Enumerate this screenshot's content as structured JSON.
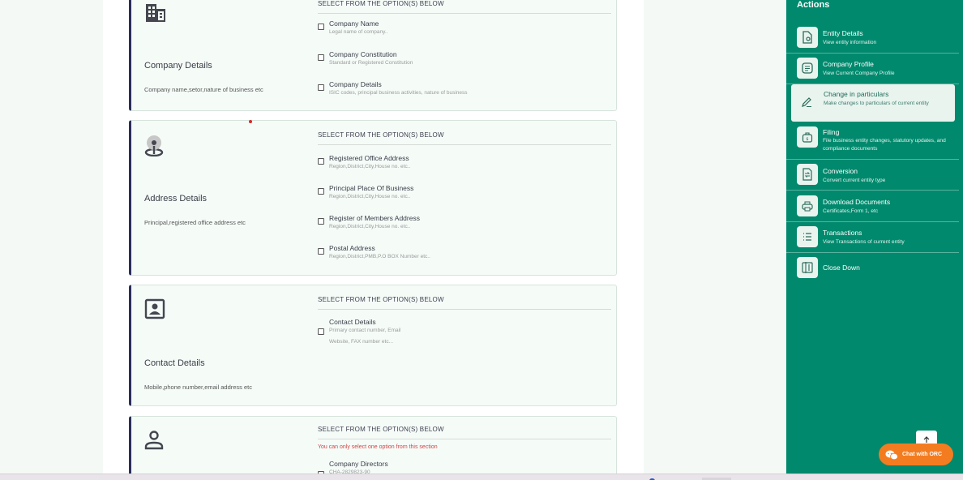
{
  "select_header": "SELECT FROM THE OPTION(S) BELOW",
  "cards": {
    "company": {
      "title": "Company Details",
      "desc": "Company name,setor,nature of business etc",
      "icon": "building-icon",
      "options": [
        {
          "label": "Company Name",
          "sub": "Legal name of company.."
        },
        {
          "label": "Company Constitution",
          "sub": "Standard or Registered Constitution"
        },
        {
          "label": "Company Details",
          "sub": "ISIC codes, principal business activities, nature of business"
        }
      ]
    },
    "address": {
      "title": "Address Details",
      "desc": "Principal,registered office address etc",
      "icon": "location-pin-icon",
      "options": [
        {
          "label": "Registered Office Address",
          "sub": "Region,District,City,House no. etc.."
        },
        {
          "label": "Principal Place Of Business",
          "sub": "Region,District,City,House no. etc.."
        },
        {
          "label": "Register of Members Address",
          "sub": "Region,District,City,House no. etc.."
        },
        {
          "label": "Postal Address",
          "sub": "Region,District,PMB,P.O BOX Number etc.."
        }
      ]
    },
    "contact": {
      "title": "Contact Details",
      "desc": "Mobile,phone number,email address etc",
      "icon": "contact-card-icon",
      "options": [
        {
          "label": "Contact Details",
          "sub": "Primary contact number, Email",
          "sub2": "Website, FAX number etc..."
        }
      ]
    },
    "directors": {
      "icon": "person-icon",
      "warning": "You can only select one option from this section",
      "options": [
        {
          "label": "Company Directors",
          "sub": "CHA-2829823-90"
        }
      ]
    }
  },
  "sidebar": {
    "title": "Actions",
    "items": [
      {
        "label": "Entity Details",
        "sub": "View entity information",
        "icon": "document-search-icon"
      },
      {
        "label": "Company Profile",
        "sub": "View Current Company Profile",
        "icon": "profile-list-icon"
      },
      {
        "label": "Change in particulars",
        "sub": "Make changes to particulars of current entity",
        "icon": "pencil-icon"
      },
      {
        "label": "Filing",
        "sub": "File business entity changes, statutory updates, and compliance documents",
        "icon": "filing-bag-icon"
      },
      {
        "label": "Conversion",
        "sub": "Convert current entity type",
        "icon": "conversion-icon"
      },
      {
        "label": "Download Documents",
        "sub": "Certificates,Form 1, etc",
        "icon": "printer-icon"
      },
      {
        "label": "Transactions",
        "sub": "View Transactions of current entity",
        "icon": "list-icon"
      },
      {
        "label": "Close Down",
        "sub": "",
        "icon": "close-down-icon"
      }
    ]
  },
  "chat": {
    "label": "Chat with ORC"
  },
  "colors": {
    "sidebar": "#00896d",
    "accent_border": "#2a2e5b",
    "chat": "#f47c20",
    "warning": "#d04545"
  }
}
